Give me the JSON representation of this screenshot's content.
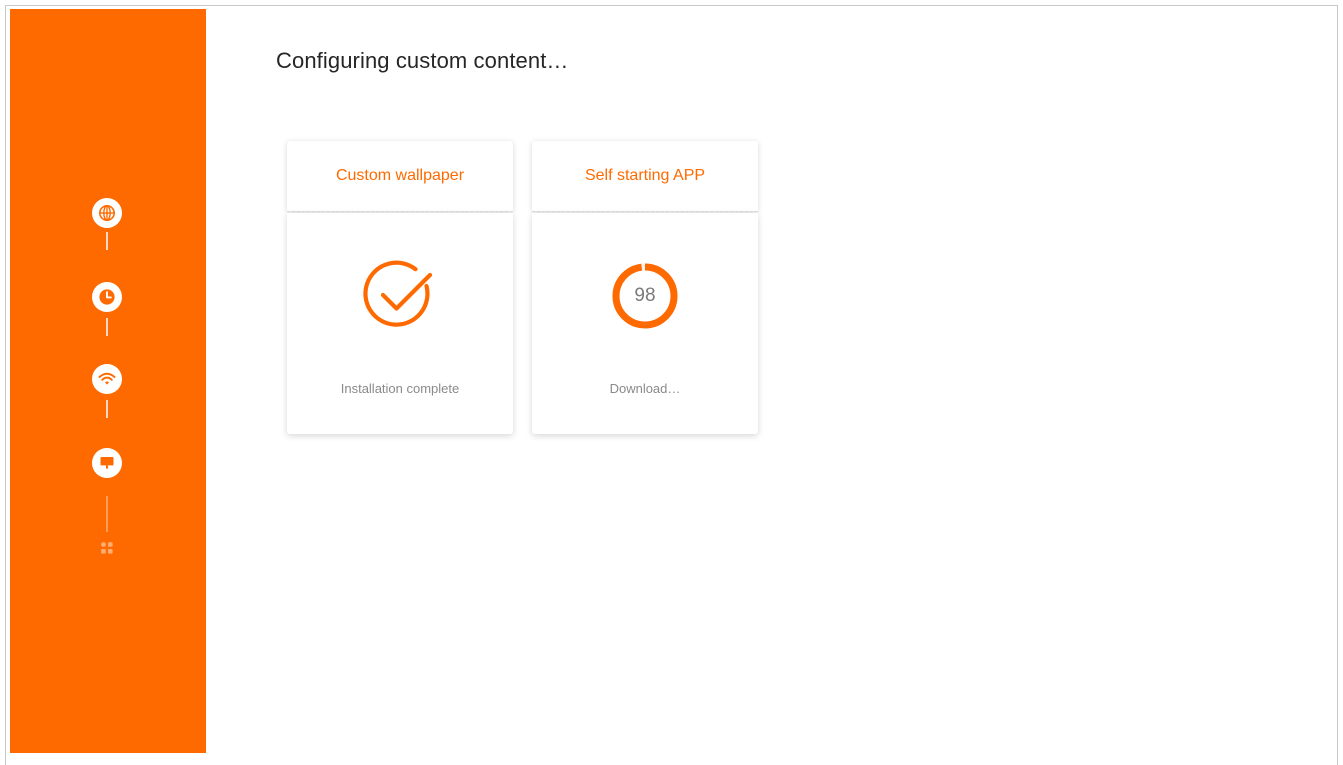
{
  "colors": {
    "accent": "#ff6a00",
    "sidebar": "#ff6a00",
    "muted_text": "#8a8a8a",
    "title_text": "#262626"
  },
  "sidebar": {
    "steps": [
      {
        "icon": "globe-icon",
        "state": "done"
      },
      {
        "icon": "clock-icon",
        "state": "done"
      },
      {
        "icon": "wifi-icon",
        "state": "done"
      },
      {
        "icon": "display-icon",
        "state": "current"
      },
      {
        "icon": "apps-grid-icon",
        "state": "pending"
      }
    ]
  },
  "page": {
    "title": "Configuring custom content…"
  },
  "cards": [
    {
      "title": "Custom wallpaper",
      "icon": "check-circle-icon",
      "status": "Installation complete"
    },
    {
      "title": "Self starting APP",
      "icon": "progress-ring",
      "progress": 98,
      "progress_label": "98",
      "status": "Download…"
    }
  ]
}
